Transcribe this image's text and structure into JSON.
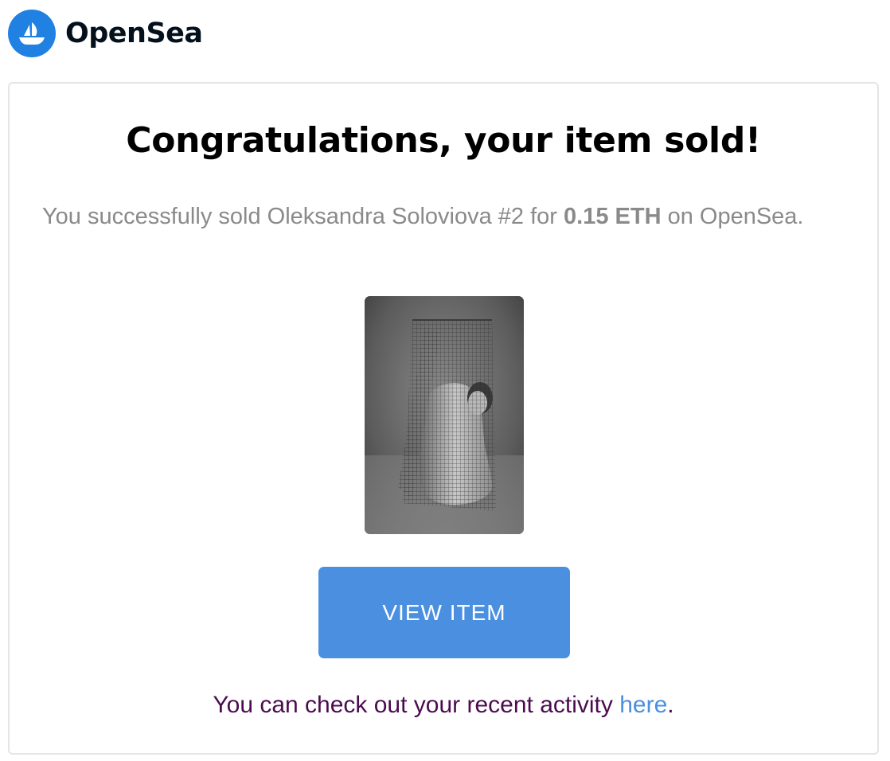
{
  "brand": {
    "logo_icon": "opensea-ship-icon",
    "name": "OpenSea",
    "logo_color": "#2081e2"
  },
  "email": {
    "title": "Congratulations, your item sold!",
    "message": {
      "prefix": "You successfully sold Oleksandra Soloviova #2 for ",
      "amount": "0.15 ETH",
      "suffix": " on OpenSea."
    },
    "image": {
      "icon": "nft-artwork-image"
    },
    "button_label": "VIEW ITEM",
    "button_color": "#4a8fe0",
    "footer": {
      "text": "You can check out your recent activity ",
      "link_text": "here",
      "end": "."
    }
  }
}
